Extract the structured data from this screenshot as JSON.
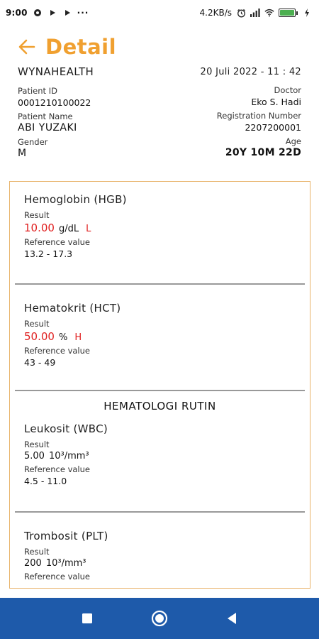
{
  "status_bar": {
    "time": "9:00",
    "overflow": "···",
    "speed": "4.2KB/s",
    "icons": [
      "chat-icon",
      "play-icon",
      "play-icon",
      "alarm-icon",
      "signal-icon",
      "wifi-icon",
      "battery-icon",
      "charging-icon"
    ]
  },
  "header": {
    "title": "Detail",
    "accent_color": "#f0a030",
    "back_icon": "arrow-left-icon"
  },
  "patient": {
    "lab_name": "WYNAHEALTH",
    "date": "20 Juli 2022 - 11 : 42",
    "patient_id_label": "Patient ID",
    "patient_id": "0001210100022",
    "patient_name_label": "Patient Name",
    "patient_name": "ABI YUZAKI",
    "gender_label": "Gender",
    "gender": "M",
    "doctor_label": "Doctor",
    "doctor": "Eko S. Hadi",
    "registration_label": "Registration Number",
    "registration_number": "2207200001",
    "age_label": "Age",
    "age": "20Y 10M 22D"
  },
  "results": {
    "border_color": "#e8b36a",
    "flag_color": "#e02020",
    "section_title": "HEMATOLOGI RUTIN",
    "result_label": "Result",
    "reference_label": "Reference value",
    "tests": [
      {
        "name": "Hemoglobin (HGB)",
        "value": "10.00",
        "unit": "g/dL",
        "flag": "L",
        "reference": "13.2 - 17.3"
      },
      {
        "name": "Hematokrit (HCT)",
        "value": "50.00",
        "unit": "%",
        "flag": "H",
        "reference": "43 - 49"
      },
      {
        "name": "Leukosit (WBC)",
        "value": "5.00",
        "unit": "10³/mm³",
        "flag": "",
        "reference": "4.5 - 11.0"
      },
      {
        "name": "Trombosit (PLT)",
        "value": "200",
        "unit": "10³/mm³",
        "flag": "",
        "reference": ""
      }
    ]
  },
  "nav_bar": {
    "color": "#1e5aaa",
    "buttons": [
      "recents-square-icon",
      "home-circle-icon",
      "back-triangle-icon"
    ]
  }
}
